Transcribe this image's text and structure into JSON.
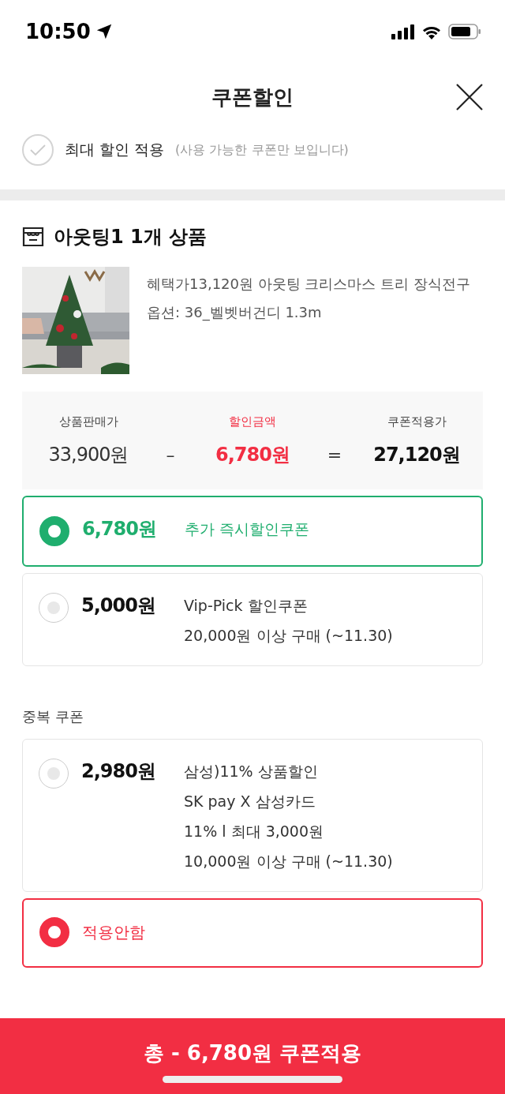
{
  "status_bar": {
    "time": "10:50"
  },
  "header": {
    "title": "쿠폰할인"
  },
  "max_discount": {
    "checked": false,
    "label": "최대 할인 적용",
    "note": "(사용 가능한 쿠폰만 보입니다)"
  },
  "store": {
    "name": "아웃팅1 1개 상품"
  },
  "product": {
    "description": "혜택가13,120원 아웃팅 크리스마스 트리 장식전구",
    "option": "옵션: 36_벨벳버건디 1.3m"
  },
  "summary": [
    {
      "kind": "price",
      "label": "상품판매가",
      "value": "33,900원"
    },
    {
      "kind": "operator",
      "value": "–"
    },
    {
      "kind": "discount",
      "label": "할인금액",
      "value": "6,780원"
    },
    {
      "kind": "operator",
      "value": "="
    },
    {
      "kind": "result",
      "label": "쿠폰적용가",
      "value": "27,120원"
    }
  ],
  "coupon_groups": [
    {
      "color": "#1fae6e",
      "coupons": [
        {
          "kind": "coupon",
          "selected": true,
          "amount": "6,780원",
          "lines": [
            "추가 즉시할인쿠폰"
          ]
        },
        {
          "kind": "coupon",
          "selected": false,
          "amount": "5,000원",
          "lines": [
            "Vip-Pick 할인쿠폰",
            "20,000원 이상 구매 (~11.30)"
          ]
        }
      ]
    },
    {
      "title": "중복 쿠폰",
      "color": "#f22e43",
      "coupons": [
        {
          "kind": "coupon",
          "selected": false,
          "amount": "2,980원",
          "lines": [
            "삼성)11% 상품할인",
            "SK pay X 삼성카드",
            "11% l 최대 3,000원",
            "10,000원 이상 구매 (~11.30)"
          ]
        },
        {
          "kind": "none",
          "selected": true,
          "label": "적용안함"
        }
      ]
    }
  ],
  "apply_button": {
    "label": "총 - 6,780원 쿠폰적용"
  }
}
